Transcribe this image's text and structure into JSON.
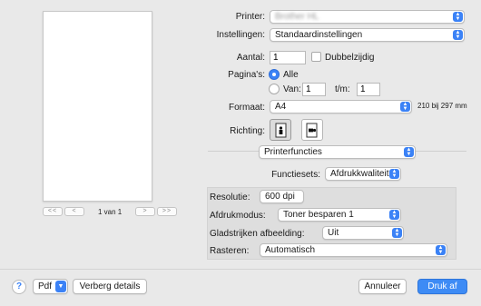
{
  "preview": {
    "page_indicator": "1 van 1",
    "first_label": "<<",
    "prev_label": "<",
    "next_label": ">",
    "last_label": ">>"
  },
  "printer": {
    "label": "Printer:",
    "value": "Brother HL"
  },
  "presets": {
    "label": "Instellingen:",
    "value": "Standaardinstellingen"
  },
  "copies": {
    "label": "Aantal:",
    "value": "1",
    "duplex_label": "Dubbelzijdig",
    "duplex_checked": false
  },
  "pages": {
    "label": "Pagina's:",
    "all_label": "Alle",
    "from_label": "Van:",
    "from_value": "1",
    "to_label": "t/m:",
    "to_value": "1",
    "selected": "Alle"
  },
  "paper": {
    "label": "Formaat:",
    "value": "A4",
    "dimensions": "210 bij 297 mm"
  },
  "orientation": {
    "label": "Richting:",
    "selected": "portrait"
  },
  "section": {
    "value": "Printerfuncties"
  },
  "feature_sets": {
    "label": "Functiesets:",
    "value": "Afdrukkwaliteit"
  },
  "quality": {
    "resolution_label": "Resolutie:",
    "resolution_value": "600 dpi",
    "mode_label": "Afdrukmodus:",
    "mode_value": "Toner besparen 1",
    "smoothing_label": "Gladstrijken afbeelding:",
    "smoothing_value": "Uit",
    "raster_label": "Rasteren:",
    "raster_value": "Automatisch"
  },
  "footer": {
    "help_label": "?",
    "pdf_label": "Pdf",
    "details_label": "Verberg details",
    "cancel_label": "Annuleer",
    "print_label": "Druk af"
  },
  "colors": {
    "accent": "#3b82f6",
    "background": "#e9e9e9"
  }
}
